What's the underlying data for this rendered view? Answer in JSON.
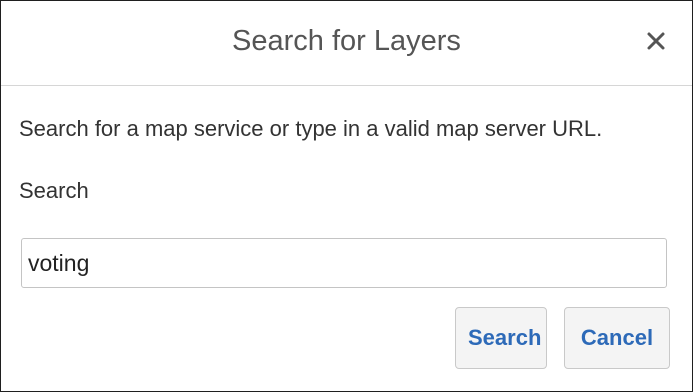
{
  "dialog": {
    "title": "Search for Layers",
    "close_icon": "close-icon"
  },
  "body": {
    "instruction": "Search for a map service or type in a valid map server URL.",
    "search_label": "Search",
    "search_value": "voting"
  },
  "footer": {
    "search_label": "Search",
    "cancel_label": "Cancel"
  },
  "colors": {
    "border": "#1f1f1f",
    "header_divider": "#d6d6d6",
    "button_text": "#2d6ab8",
    "button_bg": "#f4f4f4"
  }
}
